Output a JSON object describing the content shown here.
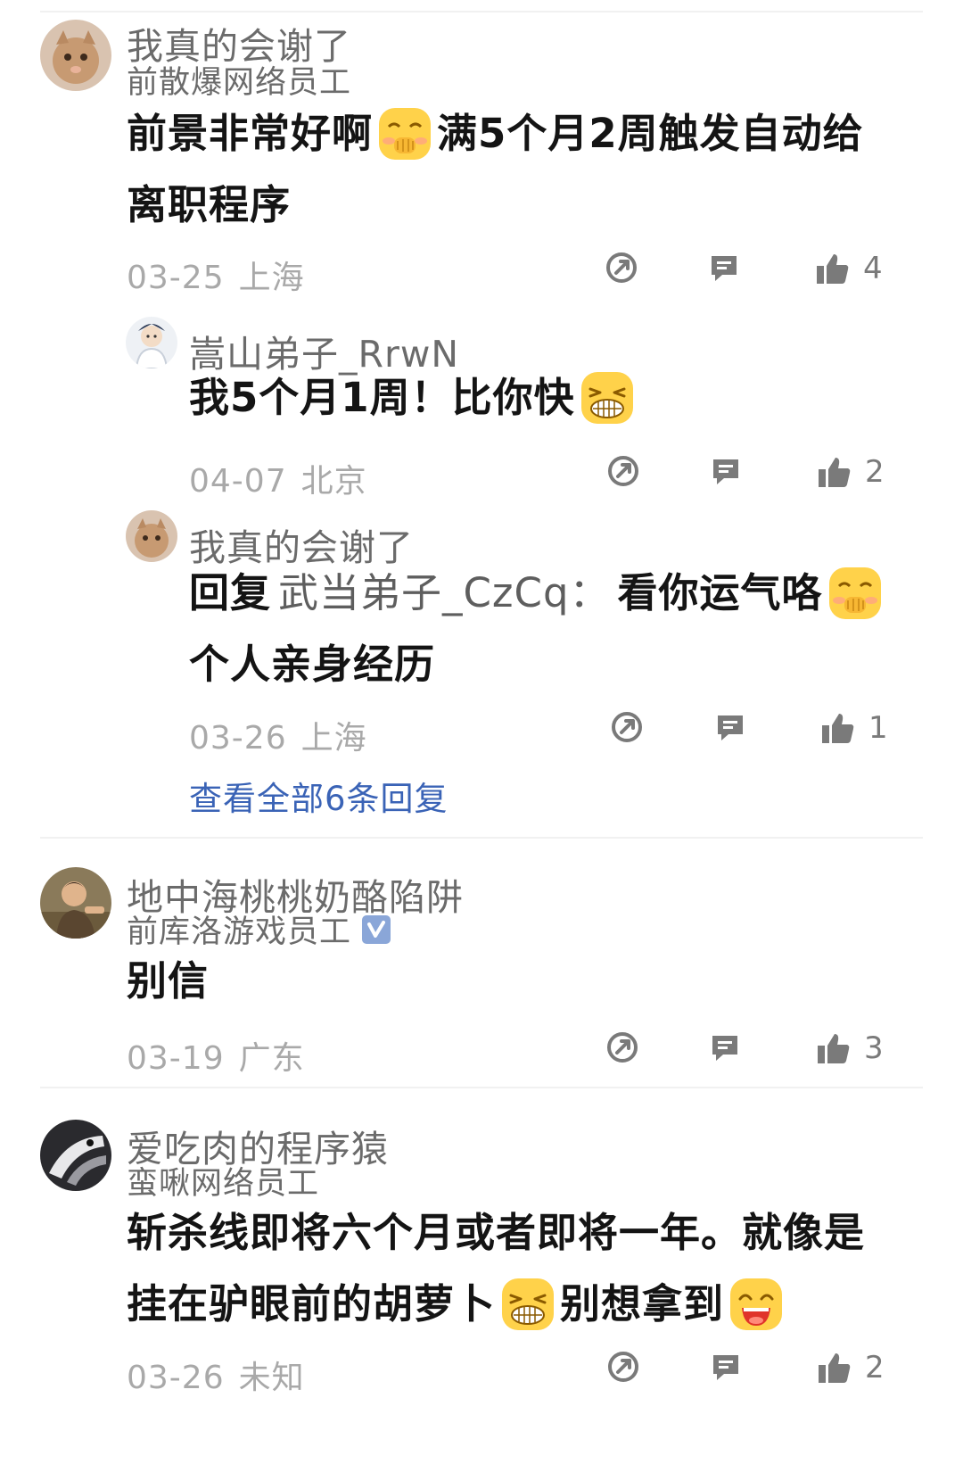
{
  "comments": [
    {
      "user": "我真的会谢了",
      "title": "前散爆网络员工",
      "lines": [
        "前景非常好啊",
        "满5个月2周触发自动给",
        "离职程序"
      ],
      "emoji": "covering-mouth-laugh-emoji",
      "date": "03-25",
      "location": "上海",
      "likes": "4"
    },
    {
      "user": "嵩山弟子_RrwN",
      "text": "我5个月1周！比你快",
      "emoji": "grin-emoji",
      "date": "04-07",
      "location": "北京",
      "likes": "2"
    },
    {
      "user": "我真的会谢了",
      "reply_label": "回复",
      "mention": "武当弟子_CzCq：",
      "text_line1": "看你运气咯",
      "text_line2": "个人亲身经历",
      "emoji": "covering-mouth-laugh-emoji",
      "date": "03-26",
      "location": "上海",
      "likes": "1"
    },
    {
      "more_replies": "查看全部6条回复"
    },
    {
      "user": "地中海桃桃奶酪陷阱",
      "title": "前库洛游戏员工",
      "badge": "verified-badge-icon",
      "text": "别信",
      "date": "03-19",
      "location": "广东",
      "likes": "3"
    },
    {
      "user": "爱吃肉的程序猿",
      "title": "蛮啾网络员工",
      "line1": "斩杀线即将六个月或者即将一年。就像是",
      "line2a": "挂在驴眼前的胡萝卜",
      "line2b": "别想拿到",
      "emojis": [
        "grin-emoji",
        "laughing-open-mouth-emoji"
      ],
      "date": "03-26",
      "location": "未知",
      "likes": "2"
    }
  ],
  "colors": {
    "link": "#3a63b6",
    "meta": "#a9a9a9",
    "name": "#6b6b6b",
    "emoji_face": "#ffd24a"
  }
}
